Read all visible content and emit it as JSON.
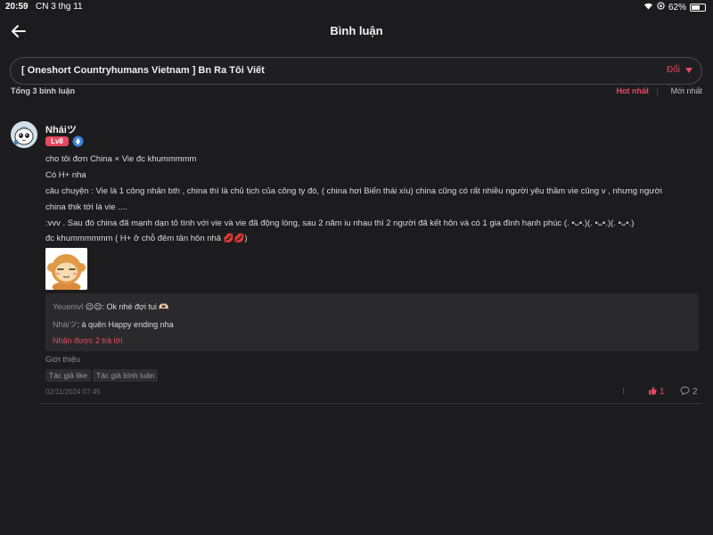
{
  "status_bar": {
    "time": "20:59",
    "date": "CN 3 thg 11",
    "battery": "62%",
    "battery_level": 0.62
  },
  "nav": {
    "title": "Bình luận"
  },
  "story": {
    "title": "[ Oneshort Countryhumans Vietnam ] Bn Ra Tôi Viết",
    "change_label": "Đổi"
  },
  "sort": {
    "total_label": "Tổng 3 bình luận",
    "hot_label": "Hot nhất",
    "new_label": "Mới nhất"
  },
  "comment": {
    "username": "Nháiツ",
    "level": "Lv8",
    "lines": [
      "cho tôi đơn China × Vie đc khummmmm",
      "Có H+ nha",
      "câu chuyện : Vie là 1 công nhân bth , china thì là chủ tịch của công ty đó, ( china hơi Biến thái xíu) china cũng có rất nhiều người yêu thầm vie cũng v , nhưng người",
      "china thik tới là vie ....",
      ":vvv . Sau đó china đã mạnh dạn tỏ tình với vie và vie đã động lòng, sau 2 năm iu nhau thì 2 người đã kết hôn và có 1 gia đình hạnh phúc (. •ᴗ•.)(. •ᴗ•.)(. •ᴗ•.)",
      "đc khummmmmm ( H+ ở chỗ đêm tân hôn nhâ 💋💋)"
    ],
    "replies": [
      {
        "user": "Yeuemvl",
        "text": " 😉😉: Ok nhé đợi tui 🫶🏻"
      },
      {
        "user": "Nháiツ",
        "text": ": à quên Happy ending nha"
      }
    ],
    "replies_more": "Nhận được 2 trả lời",
    "intro_label": "Giới thiệu",
    "tags": [
      "Tác giả like",
      "Tác giả bình luận"
    ],
    "timestamp": "02/11/2024 07:45",
    "likes": "1",
    "reply_count": "2"
  },
  "colors": {
    "accent": "#e84860",
    "background": "#1c1c1e"
  }
}
